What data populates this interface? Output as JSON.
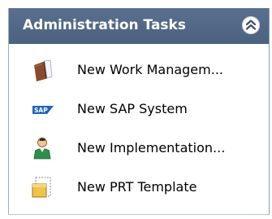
{
  "panel": {
    "title": "Administration Tasks",
    "collapse_icon": "double-chevron-up-icon",
    "tasks": [
      {
        "label": "New Work Managem...",
        "icon": "work-management-book-icon"
      },
      {
        "label": "New SAP System",
        "icon": "sap-logo-icon"
      },
      {
        "label": "New Implementation...",
        "icon": "user-person-icon"
      },
      {
        "label": "New PRT Template",
        "icon": "template-document-icon"
      }
    ]
  },
  "colors": {
    "header_bg": "#506885",
    "header_text": "#ffffff",
    "sap_blue": "#1f63b5"
  }
}
